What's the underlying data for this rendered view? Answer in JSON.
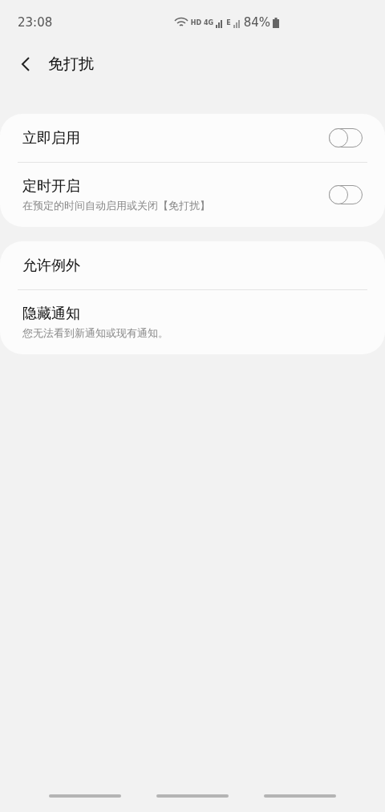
{
  "status_bar": {
    "time": "23:08",
    "hd": "HD",
    "network": "4G",
    "network_2": "E",
    "battery": "84%"
  },
  "header": {
    "title": "免打扰"
  },
  "groups": [
    {
      "items": [
        {
          "kind": "toggle",
          "title": "立即启用",
          "on": false
        },
        {
          "kind": "toggle",
          "title": "定时开启",
          "subtitle": "在预定的时间自动启用或关闭【免打扰】",
          "on": false
        }
      ]
    },
    {
      "items": [
        {
          "kind": "link",
          "title": "允许例外"
        },
        {
          "kind": "link",
          "title": "隐藏通知",
          "subtitle": "您无法看到新通知或现有通知。"
        }
      ]
    }
  ]
}
